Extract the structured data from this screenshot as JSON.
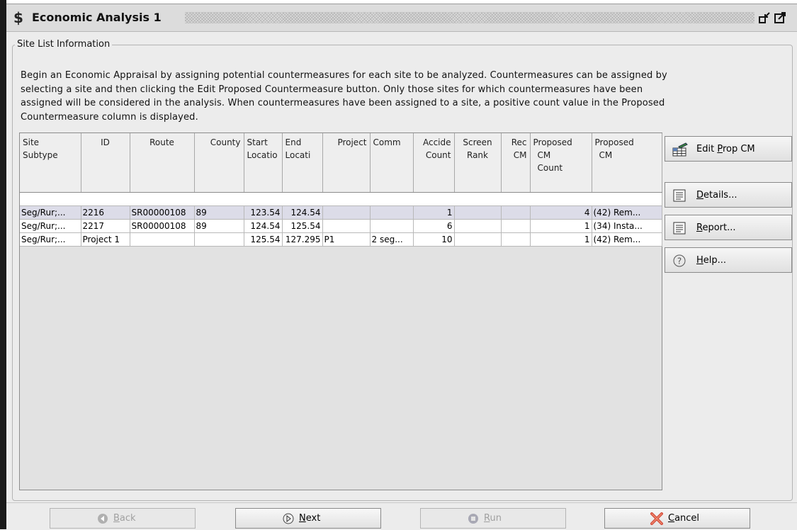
{
  "window": {
    "icon": "dollar-sign-icon",
    "title": "Economic Analysis 1"
  },
  "group": {
    "label": "Site List Information"
  },
  "intro": {
    "line1": "Begin an Economic Appraisal by assigning potential countermeasures for each site to be analyzed. Countermeasures can be assigned by",
    "line2": "selecting a site and then clicking the Edit Proposed Countermeasure button. Only those sites for which countermeasures have been",
    "line3": "assigned will be considered in the analysis. When countermeasures have been assigned to a site, a positive count value in the Proposed",
    "line4": "Countermeasure column is displayed."
  },
  "table": {
    "headers": [
      {
        "l1": "Site",
        "l2": "Subtype",
        "l3": ""
      },
      {
        "l1": "ID",
        "l2": "",
        "l3": ""
      },
      {
        "l1": "Route",
        "l2": "",
        "l3": ""
      },
      {
        "l1": "County",
        "l2": "",
        "l3": ""
      },
      {
        "l1": "Start",
        "l2": "Locatio",
        "l3": ""
      },
      {
        "l1": "End",
        "l2": "Locati",
        "l3": ""
      },
      {
        "l1": "Project",
        "l2": "",
        "l3": ""
      },
      {
        "l1": "Comm",
        "l2": "",
        "l3": ""
      },
      {
        "l1": "Accide",
        "l2": "Count",
        "l3": ""
      },
      {
        "l1": "Screen",
        "l2": "Rank",
        "l3": ""
      },
      {
        "l1": "Rec",
        "l2": "CM",
        "l3": ""
      },
      {
        "l1": "Proposed",
        "l2": "CM",
        "l3": "Count"
      },
      {
        "l1": "Proposed",
        "l2": "CM",
        "l3": ""
      }
    ],
    "rows": [
      [
        "Seg/Rur;...",
        "2216",
        "SR00000108",
        "89",
        "123.54",
        "124.54",
        "",
        "",
        "1",
        "",
        "",
        "4",
        "(42) Rem..."
      ],
      [
        "Seg/Rur;...",
        "2217",
        "SR00000108",
        "89",
        "124.54",
        "125.54",
        "",
        "",
        "6",
        "",
        "",
        "1",
        "(34) Insta..."
      ],
      [
        "Seg/Rur;...",
        "Project 1",
        "",
        "",
        "125.54",
        "127.295",
        "P1",
        "2 seg...",
        "10",
        "",
        "",
        "1",
        "(42) Rem..."
      ]
    ]
  },
  "side_buttons": {
    "edit": {
      "pre": "Edit ",
      "u": "P",
      "post": "rop CM"
    },
    "details": {
      "pre": "",
      "u": "D",
      "post": "etails..."
    },
    "report": {
      "pre": "",
      "u": "R",
      "post": "eport..."
    },
    "help": {
      "pre": "",
      "u": "H",
      "post": "elp..."
    }
  },
  "nav_buttons": {
    "back": {
      "u": "B",
      "post": "ack"
    },
    "next": {
      "u": "N",
      "post": "ext"
    },
    "run": {
      "u": "R",
      "post": "un"
    },
    "cancel": {
      "u": "C",
      "post": "ancel"
    }
  }
}
